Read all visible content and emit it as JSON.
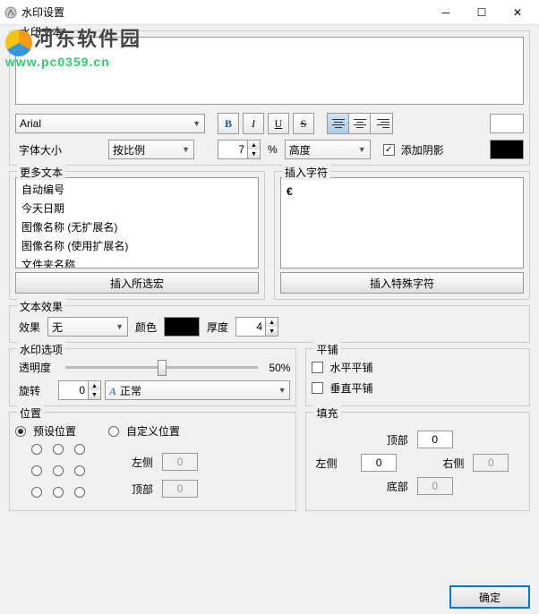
{
  "window": {
    "title": "水印设置"
  },
  "watermark_overlay": {
    "brand": "河东软件园",
    "url": "www.pc0359.cn"
  },
  "section_text": {
    "legend": "水印文本",
    "textarea_value": "",
    "font_name": "Arial",
    "style_buttons": {
      "bold": "B",
      "italic": "I",
      "underline": "U",
      "strike": "S"
    },
    "text_color": "#ffffff",
    "font_size_label": "字体大小",
    "size_mode": "按比例",
    "size_value": "7",
    "size_unit": "%",
    "height_mode": "高度",
    "shadow_checked": true,
    "shadow_label": "添加阴影",
    "shadow_color": "#000000"
  },
  "section_more_text": {
    "legend": "更多文本",
    "items": [
      "自动编号",
      "今天日期",
      "图像名称 (无扩展名)",
      "图像名称 (使用扩展名)",
      "文件夹名称"
    ],
    "insert_btn": "插入所选宏"
  },
  "section_insert_char": {
    "legend": "插入字符",
    "sample_char": "€",
    "insert_btn": "插入特殊字符"
  },
  "section_text_effect": {
    "legend": "文本效果",
    "effect_label": "效果",
    "effect_value": "无",
    "color_label": "颜色",
    "color_value": "#000000",
    "thickness_label": "厚度",
    "thickness_value": "4"
  },
  "section_watermark_opts": {
    "legend": "水印选项",
    "opacity_label": "透明度",
    "opacity_value": "50%",
    "rotate_label": "旋转",
    "rotate_value": "0",
    "normal_label": "正常"
  },
  "section_tile": {
    "legend": "平铺",
    "horiz": "水平平铺",
    "vert": "垂直平铺"
  },
  "section_position": {
    "legend": "位置",
    "preset_label": "预设位置",
    "custom_label": "自定义位置",
    "left_label": "左侧",
    "left_value": "0",
    "top_label": "顶部",
    "top_value": "0"
  },
  "section_fill": {
    "legend": "填充",
    "left_label": "左侧",
    "left_value": "0",
    "top_label": "顶部",
    "top_value": "0",
    "right_label": "右侧",
    "right_value": "0",
    "bottom_label": "底部",
    "bottom_value": "0"
  },
  "buttons": {
    "ok": "确定"
  }
}
